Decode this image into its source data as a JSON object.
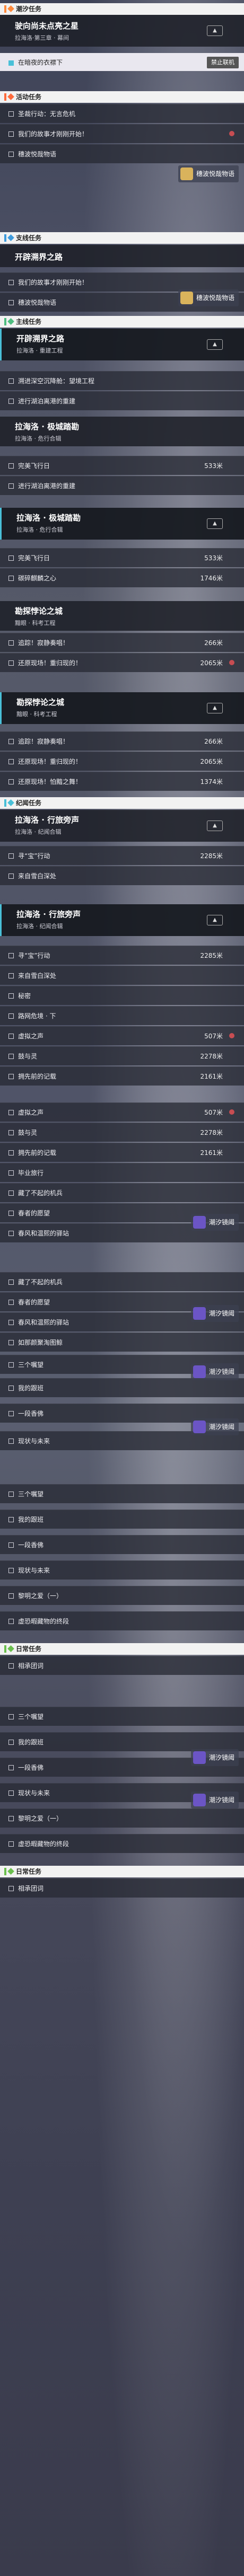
{
  "colors": {
    "orange": "#ff8a3c",
    "teal": "#49c0d8",
    "blue": "#3f9bdc",
    "green": "#4ebd80",
    "purple": "#6b55c5"
  },
  "sec1": {
    "title": "潮汐任务"
  },
  "q1": {
    "title": "驶向尚未点亮之星",
    "sub": "拉海洛·第三章 · 幕间"
  },
  "tracked": {
    "label": "在暗夜的衣襟下",
    "badge": "禁止联机"
  },
  "sec2": {
    "title": "活动任务"
  },
  "a1": "圣裁行动：无言危机",
  "a2": "我们的故事才刚刚开始！",
  "a3": "穗波悦哉物语",
  "tip1": "穗波悦哉物语",
  "sec3": {
    "title": "支线任务"
  },
  "b1": "我们的故事才刚刚开始！",
  "b2": "穗波悦哉物语",
  "tip2": "穗波悦哉物语",
  "sec4": {
    "title": "主线任务"
  },
  "q2": {
    "title": "开辟溯界之路",
    "sub": "拉海洛 · 重建工程"
  },
  "q2b": {
    "title": "开辟溯界之路",
    "sub": "拉海洛 · 重建工程"
  },
  "c1": "溯进深空沉降舱：望境工程",
  "c2": "进行湖泊离港的重建",
  "q3": {
    "title": "拉海洛 · 极城踏勘",
    "sub": "拉海洛 · 危行合辑"
  },
  "d1": {
    "label": "完美飞行日",
    "dist": "533米"
  },
  "d2": "进行湖泊离港的重建",
  "q4": {
    "title": "拉海洛 · 极城踏勘",
    "sub": "拉海洛 · 危行合辑"
  },
  "e1": {
    "label": "完美飞行日",
    "dist": "533米"
  },
  "e2": {
    "label": "碳碎麒麟之心",
    "dist": "1746米"
  },
  "q5": {
    "title": "勘探悖论之城",
    "sub": "黯眼 · 科考工程"
  },
  "f1": {
    "label": "追踪！寂静奏唱！",
    "dist": "266米"
  },
  "f2": {
    "label": "还原现场！重归现的！",
    "dist": "2065米"
  },
  "q6": {
    "title": "勘探悖论之城",
    "sub": "黯眼 · 科考工程"
  },
  "g1": {
    "label": "追踪！寂静奏唱！",
    "dist": "266米"
  },
  "g2": {
    "label": "还原现场！重归现的！",
    "dist": "2065米"
  },
  "g3": {
    "label": "还原现场！怕黯之舞！",
    "dist": "1374米"
  },
  "sec5": {
    "title": "纪闻任务"
  },
  "q7": {
    "title": "拉海洛 · 行旅旁声",
    "sub": "拉海洛 · 纪闻合辑"
  },
  "h1": {
    "label": "寻“宝”行动",
    "dist": "2285米"
  },
  "h2": "来自雪白深处",
  "q8": {
    "title": "拉海洛 · 行旅旁声",
    "sub": "拉海洛 · 纪闻合辑"
  },
  "i1": {
    "label": "寻“宝”行动",
    "dist": "2285米"
  },
  "i2": "来自雪白深处",
  "i3": "秘密",
  "i4": "路网危境 · 下",
  "i5": {
    "label": "虚拟之声",
    "dist": "507米"
  },
  "i6": {
    "label": "鼓与灵",
    "dist": "2278米"
  },
  "i7": {
    "label": "拥先前的记载",
    "dist": "2161米"
  },
  "j1": {
    "label": "虚拟之声",
    "dist": "507米"
  },
  "j2": {
    "label": "鼓与灵",
    "dist": "2278米"
  },
  "j3": {
    "label": "拥先前的记载",
    "dist": "2161米"
  },
  "j4": "毕业旅行",
  "j5": "藏了不起的机兵",
  "j6": "春者的愿望",
  "j7": "春风和温熙的驿站",
  "tip3": "潮汐镜阈",
  "k1": "藏了不起的机兵",
  "k2": "春者的愿望",
  "k3": "春风和温熙的驿站",
  "k4": "如那颜聚淘图鲸",
  "k5": "三个嘱望",
  "k6": "我的跟班",
  "k7": "一段香佛",
  "k8": "现状与未来",
  "tip4": "潮汐镜阈",
  "tip5": "潮汐镜阈",
  "tip6": "潮汐镜阈",
  "l1": "三个嘱望",
  "l2": "我的跟班",
  "l3": "一段香佛",
  "l4": "现状与未来",
  "l5": "黎明之爱（一）",
  "l6": "虚恐暇藏物的终段",
  "sec6": {
    "title": "日常任务"
  },
  "m1": "相承团词",
  "n1": "三个嘱望",
  "n2": "我的跟班",
  "n3": "一段香佛",
  "n4": "现状与未来",
  "n5": "黎明之爱（一）",
  "n6": "虚恐暇藏物的终段",
  "sec7": {
    "title": "日常任务"
  },
  "o1": "相承团词",
  "tip7": "潮汐镜阈",
  "tip8": "潮汐镜阈"
}
